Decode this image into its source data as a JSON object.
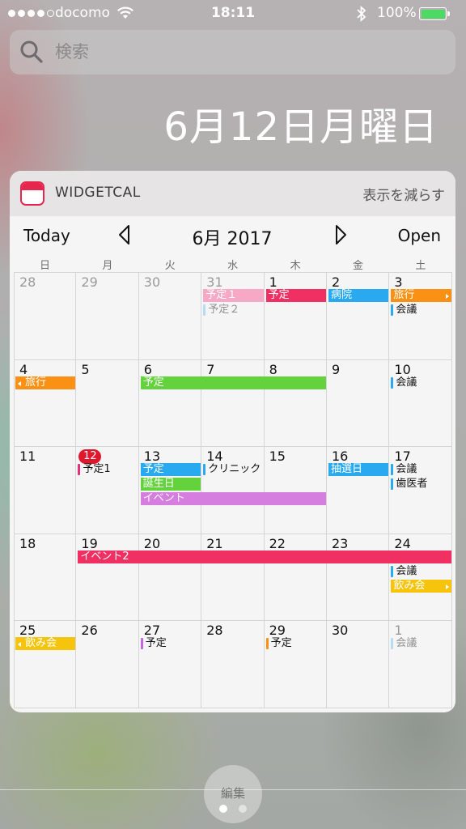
{
  "status": {
    "carrier": "docomo",
    "time": "18:11",
    "battery_percent": "100%",
    "battery_level": 1.0,
    "signal_bars": 4,
    "signal_total": 5
  },
  "search": {
    "placeholder": "検索"
  },
  "date_heading": "6月12日月曜日",
  "widget": {
    "app_name": "WIDGETCAL",
    "show_less": "表示を減らす",
    "today_label": "Today",
    "month_title": "6月 2017",
    "open_label": "Open",
    "weekdays": [
      "日",
      "月",
      "火",
      "水",
      "木",
      "金",
      "土"
    ],
    "weeks": [
      [
        {
          "day": "28",
          "other": true
        },
        {
          "day": "29",
          "other": true
        },
        {
          "day": "30",
          "other": true
        },
        {
          "day": "31",
          "other": true
        },
        {
          "day": "1"
        },
        {
          "day": "2"
        },
        {
          "day": "3"
        }
      ],
      [
        {
          "day": "4"
        },
        {
          "day": "5"
        },
        {
          "day": "6"
        },
        {
          "day": "7"
        },
        {
          "day": "8"
        },
        {
          "day": "9"
        },
        {
          "day": "10"
        }
      ],
      [
        {
          "day": "11"
        },
        {
          "day": "12",
          "today": true
        },
        {
          "day": "13"
        },
        {
          "day": "14"
        },
        {
          "day": "15"
        },
        {
          "day": "16"
        },
        {
          "day": "17"
        }
      ],
      [
        {
          "day": "18"
        },
        {
          "day": "19"
        },
        {
          "day": "20"
        },
        {
          "day": "21"
        },
        {
          "day": "22"
        },
        {
          "day": "23"
        },
        {
          "day": "24"
        }
      ],
      [
        {
          "day": "25"
        },
        {
          "day": "26"
        },
        {
          "day": "27"
        },
        {
          "day": "28"
        },
        {
          "day": "29"
        },
        {
          "day": "30"
        },
        {
          "day": "1",
          "other": true
        }
      ]
    ],
    "events": [
      {
        "label": "予定１",
        "week": 0,
        "start": 3,
        "span": 1,
        "lane": 0,
        "style": "bar",
        "color": "#f7a8c4"
      },
      {
        "label": "予定２",
        "week": 0,
        "start": 3,
        "span": 1,
        "lane": 1,
        "style": "line",
        "color": "#6cbcf2",
        "faded": true
      },
      {
        "label": "予定",
        "week": 0,
        "start": 4,
        "span": 1,
        "lane": 0,
        "style": "bar",
        "color": "#f03063"
      },
      {
        "label": "病院",
        "week": 0,
        "start": 5,
        "span": 1,
        "lane": 0,
        "style": "bar",
        "color": "#29aaf0"
      },
      {
        "label": "旅行",
        "week": 0,
        "start": 6,
        "span": 1,
        "lane": 0,
        "style": "bar",
        "color": "#fb9114",
        "continues_right": true
      },
      {
        "label": "会議",
        "week": 0,
        "start": 6,
        "span": 1,
        "lane": 1,
        "style": "line",
        "color": "#29aaf0"
      },
      {
        "label": "旅行",
        "week": 1,
        "start": 0,
        "span": 1,
        "lane": 0,
        "style": "bar",
        "color": "#fb9114",
        "continues_left": true
      },
      {
        "label": "予定",
        "week": 1,
        "start": 2,
        "span": 3,
        "lane": 0,
        "style": "bar",
        "color": "#64d23c"
      },
      {
        "label": "会議",
        "week": 1,
        "start": 6,
        "span": 1,
        "lane": 0,
        "style": "line",
        "color": "#29aaf0"
      },
      {
        "label": "予定1",
        "week": 2,
        "start": 1,
        "span": 1,
        "lane": 0,
        "style": "line",
        "color": "#e6307a"
      },
      {
        "label": "予定",
        "week": 2,
        "start": 2,
        "span": 1,
        "lane": 0,
        "style": "bar",
        "color": "#29aaf0"
      },
      {
        "label": "誕生日",
        "week": 2,
        "start": 2,
        "span": 1,
        "lane": 1,
        "style": "bar",
        "color": "#64d23c"
      },
      {
        "label": "イベント",
        "week": 2,
        "start": 2,
        "span": 3,
        "lane": 2,
        "style": "bar",
        "color": "#d67ee0"
      },
      {
        "label": "クリニック",
        "week": 2,
        "start": 3,
        "span": 1,
        "lane": 0,
        "style": "line",
        "color": "#29aaf0"
      },
      {
        "label": "抽選日",
        "week": 2,
        "start": 5,
        "span": 1,
        "lane": 0,
        "style": "bar",
        "color": "#29aaf0"
      },
      {
        "label": "会議",
        "week": 2,
        "start": 6,
        "span": 1,
        "lane": 0,
        "style": "line",
        "color": "#29aaf0"
      },
      {
        "label": "歯医者",
        "week": 2,
        "start": 6,
        "span": 1,
        "lane": 1,
        "style": "line",
        "color": "#29aaf0"
      },
      {
        "label": "イベント2",
        "week": 3,
        "start": 1,
        "span": 6,
        "lane": 0,
        "style": "bar",
        "color": "#f03063"
      },
      {
        "label": "会議",
        "week": 3,
        "start": 6,
        "span": 1,
        "lane": 1,
        "style": "line",
        "color": "#29aaf0"
      },
      {
        "label": "飲み会",
        "week": 3,
        "start": 6,
        "span": 1,
        "lane": 2,
        "style": "bar",
        "color": "#f6c40c",
        "continues_right": true
      },
      {
        "label": "飲み会",
        "week": 4,
        "start": 0,
        "span": 1,
        "lane": 0,
        "style": "bar",
        "color": "#f6c40c",
        "continues_left": true
      },
      {
        "label": "予定",
        "week": 4,
        "start": 2,
        "span": 1,
        "lane": 0,
        "style": "line",
        "color": "#c268e2"
      },
      {
        "label": "予定",
        "week": 4,
        "start": 4,
        "span": 1,
        "lane": 0,
        "style": "line",
        "color": "#fb9114"
      },
      {
        "label": "会議",
        "week": 4,
        "start": 6,
        "span": 1,
        "lane": 0,
        "style": "line",
        "color": "#6cbcf2",
        "faded": true
      }
    ]
  },
  "edit_label": "編集",
  "page_dots": {
    "count": 2,
    "active": 0
  }
}
